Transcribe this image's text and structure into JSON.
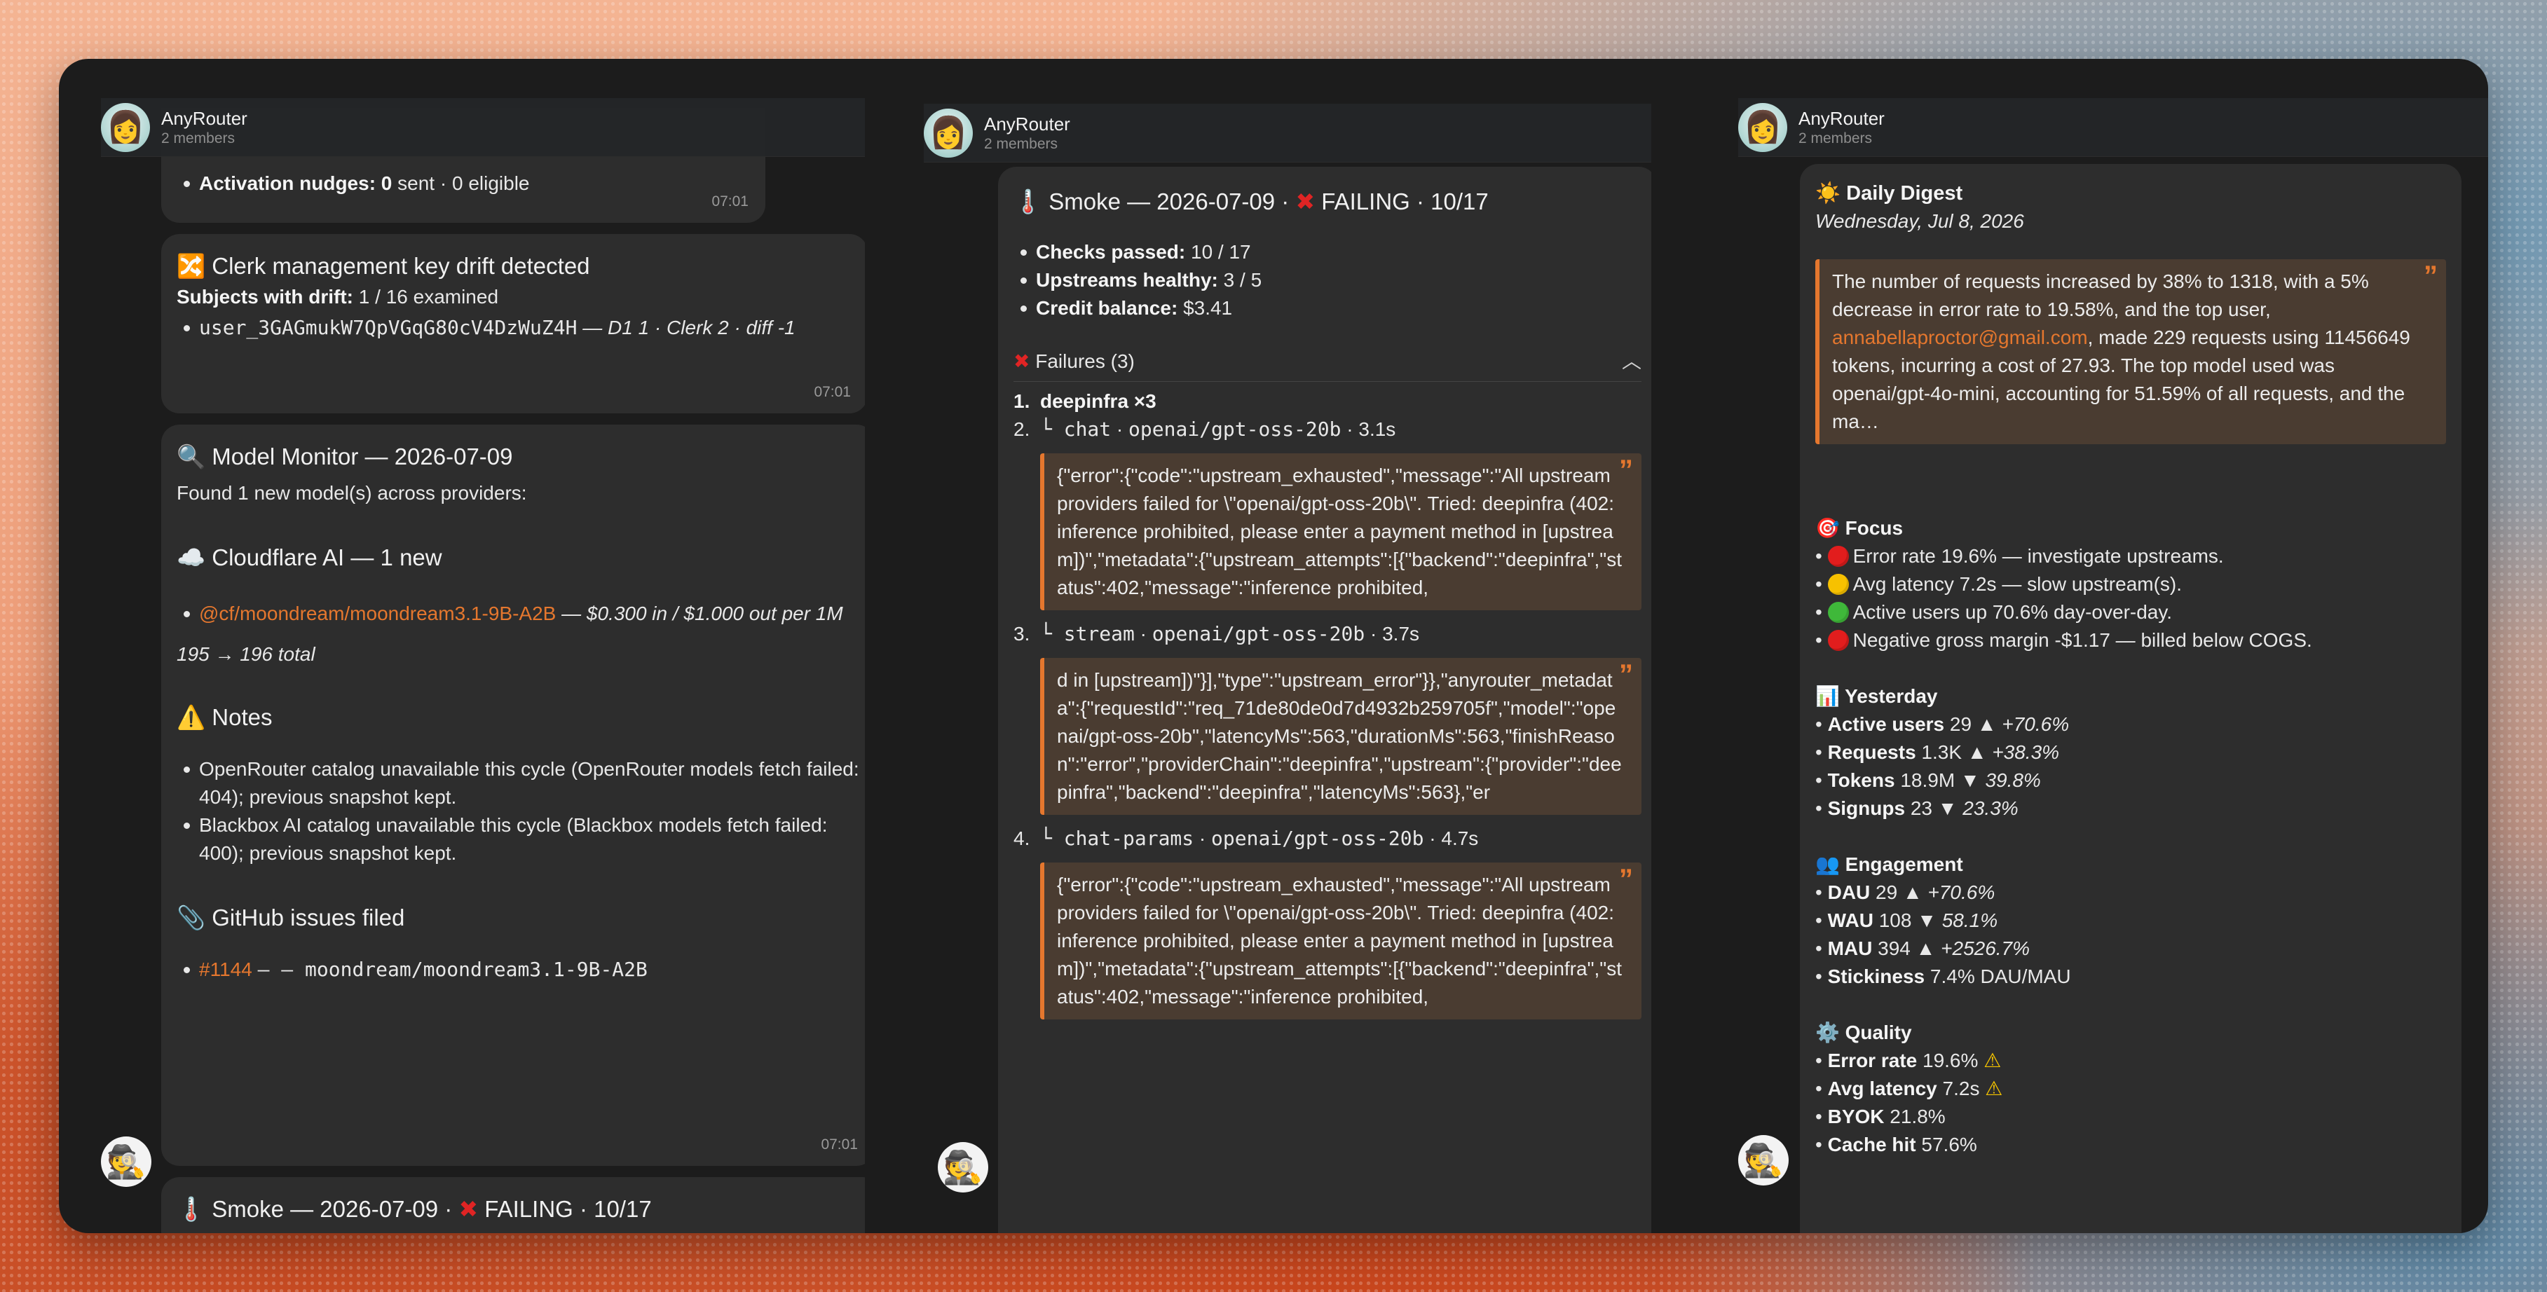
{
  "header": {
    "title": "AnyRouter",
    "members": "2 members"
  },
  "left": {
    "activation": {
      "label": "Activation nudges:",
      "value": "0",
      "rest": "sent · 0 eligible",
      "time": "07:01"
    },
    "drift": {
      "title": "Clerk management key drift detected",
      "subjects_label": "Subjects with drift:",
      "subjects_value": "1 / 16 examined",
      "user_id": "user_3GAGmukW7QpVGqG80cV4DzWuZ4H",
      "user_detail": "— D1 1 · Clerk 2 · diff -1",
      "time": "07:01"
    },
    "monitor": {
      "title": "Model Monitor — 2026-07-09",
      "found": "Found 1 new model(s) across providers:",
      "provider_title": "Cloudflare AI — 1 new",
      "model_link": "@cf/moondream/moondream3.1-9B-A2B",
      "model_price": "— $0.300 in / $1.000 out per 1M",
      "total": "195 → 196 total",
      "notes_title": "Notes",
      "notes": [
        "OpenRouter catalog unavailable this cycle (OpenRouter models fetch failed: 404); previous snapshot kept.",
        "Blackbox AI catalog unavailable this cycle (Blackbox models fetch failed: 400); previous snapshot kept."
      ],
      "issues_title": "GitHub issues filed",
      "issue_link": "#1144",
      "issue_text": "— moondream/moondream3.1-9B-A2B",
      "time": "07:01"
    },
    "smoke_preview": {
      "prefix": "Smoke — 2026-07-09 ·",
      "status": "FAILING · 10/17"
    }
  },
  "middle": {
    "smoke": {
      "prefix": "Smoke — 2026-07-09 ·",
      "status": "FAILING · 10/17",
      "checks_label": "Checks passed:",
      "checks_value": "10 / 17",
      "upstreams_label": "Upstreams healthy:",
      "upstreams_value": "3 / 5",
      "credit_label": "Credit balance:",
      "credit_value": "$3.41",
      "failures_title": "Failures (3)",
      "items": [
        {
          "num": "1.",
          "title": "deepinfra ×3"
        },
        {
          "num": "2.",
          "kind": "chat",
          "model": "openai/gpt-oss-20b",
          "dur": "· 3.1s",
          "quote": "{\"error\":{\"code\":\"upstream_exhausted\",\"message\":\"All upstream providers failed for \\\"openai/gpt-oss-20b\\\". Tried: deepinfra (402: inference prohibited, please enter a payment method in [upstream])\",\"metadata\":{\"upstream_attempts\":[{\"backend\":\"deepinfra\",\"status\":402,\"message\":\"inference prohibited,"
        },
        {
          "num": "3.",
          "kind": "stream",
          "model": "openai/gpt-oss-20b",
          "dur": "· 3.7s",
          "quote": "d in [upstream])\"}],\"type\":\"upstream_error\"}},\"anyrouter_metadata\":{\"requestId\":\"req_71de80de0d7d4932b259705f\",\"model\":\"openai/gpt-oss-20b\",\"latencyMs\":563,\"durationMs\":563,\"finishReason\":\"error\",\"providerChain\":\"deepinfra\",\"upstream\":{\"provider\":\"deepinfra\",\"backend\":\"deepinfra\",\"latencyMs\":563},\"er"
        },
        {
          "num": "4.",
          "kind": "chat-params",
          "model": "openai/gpt-oss-20b",
          "dur": "· 4.7s",
          "quote": "{\"error\":{\"code\":\"upstream_exhausted\",\"message\":\"All upstream providers failed for \\\"openai/gpt-oss-20b\\\". Tried: deepinfra (402: inference prohibited, please enter a payment method in [upstream])\",\"metadata\":{\"upstream_attempts\":[{\"backend\":\"deepinfra\",\"status\":402,\"message\":\"inference prohibited,"
        }
      ]
    }
  },
  "right": {
    "digest": {
      "title": "Daily Digest",
      "date": "Wednesday, Jul 8, 2026",
      "summary_a": "The number of requests increased by 38% to 1318, with a 5% decrease in error rate to 19.58%, and the top user,",
      "summary_email": "annabellaproctor@gmail.com",
      "summary_b": ", made 229 requests using 11456649 tokens, incurring a cost of 27.93. The top model used was openai/gpt-4o-mini, accounting for 51.59% of all requests, and the ma…",
      "focus_title": "Focus",
      "focus": [
        {
          "level": "red",
          "text": "Error rate 19.6% — investigate upstreams."
        },
        {
          "level": "yellow",
          "text": "Avg latency 7.2s — slow upstream(s)."
        },
        {
          "level": "green",
          "text": "Active users up 70.6% day-over-day."
        },
        {
          "level": "red",
          "text": "Negative gross margin -$1.17 — billed below COGS."
        }
      ],
      "yesterday_title": "Yesterday",
      "yesterday": [
        {
          "label": "Active users",
          "value": "29",
          "dir": "▲",
          "delta": "+70.6%"
        },
        {
          "label": "Requests",
          "value": "1.3K",
          "dir": "▲",
          "delta": "+38.3%"
        },
        {
          "label": "Tokens",
          "value": "18.9M",
          "dir": "▼",
          "delta": "39.8%"
        },
        {
          "label": "Signups",
          "value": "23",
          "dir": "▼",
          "delta": "23.3%"
        }
      ],
      "engagement_title": "Engagement",
      "engagement": [
        {
          "label": "DAU",
          "value": "29",
          "dir": "▲",
          "delta": "+70.6%"
        },
        {
          "label": "WAU",
          "value": "108",
          "dir": "▼",
          "delta": "58.1%"
        },
        {
          "label": "MAU",
          "value": "394",
          "dir": "▲",
          "delta": "+2526.7%"
        },
        {
          "label": "Stickiness",
          "value": "7.4% DAU/MAU",
          "dir": "",
          "delta": ""
        }
      ],
      "quality_title": "Quality",
      "quality": [
        {
          "label": "Error rate",
          "value": "19.6%",
          "warn": "⚠"
        },
        {
          "label": "Avg latency",
          "value": "7.2s",
          "warn": "⚠"
        },
        {
          "label": "BYOK",
          "value": "21.8%",
          "warn": ""
        },
        {
          "label": "Cache hit",
          "value": "57.6%",
          "warn": ""
        }
      ]
    }
  },
  "colors": {
    "accent": "#e5772e",
    "bubble": "#2d2d2d",
    "quote_bg": "#4a3c31",
    "frame": "#1c1c1c"
  },
  "icons": [
    "avatar-icon",
    "bot-avatar-icon",
    "shuffle-icon",
    "magnifier-icon",
    "cloud-icon",
    "warning-icon",
    "paperclip-icon",
    "thermometer-icon",
    "cross-icon",
    "chevron-up-icon",
    "sun-icon",
    "target-icon",
    "chart-icon",
    "people-icon",
    "gear-icon"
  ]
}
